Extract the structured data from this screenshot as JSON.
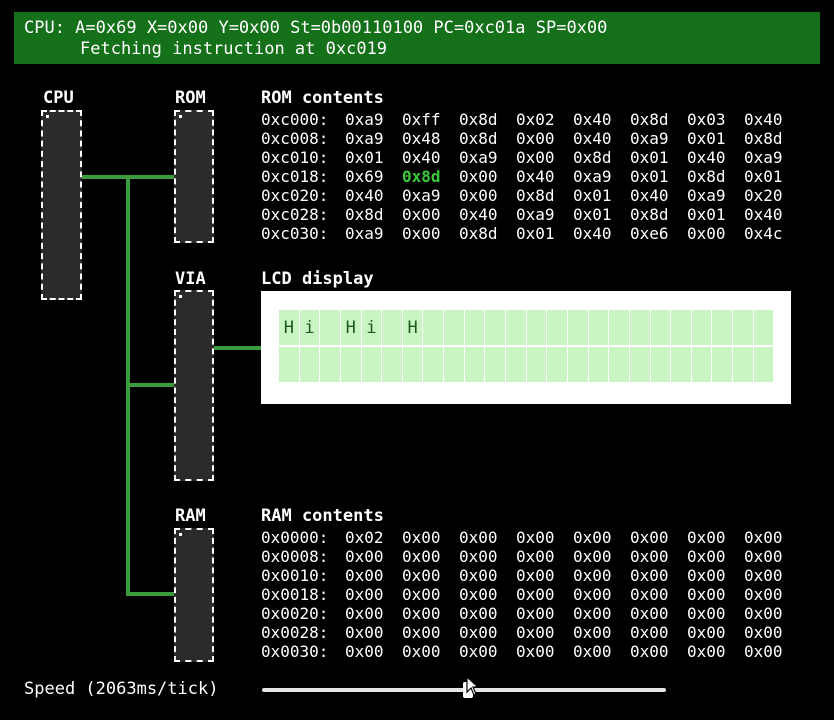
{
  "status": {
    "line1": "CPU: A=0x69  X=0x00  Y=0x00  St=0b00110100  PC=0xc01a  SP=0x00",
    "line2": "Fetching instruction at 0xc019"
  },
  "chips": {
    "cpu": "CPU",
    "rom": "ROM",
    "via": "VIA",
    "ram": "RAM"
  },
  "rom": {
    "title": "ROM contents",
    "highlight": {
      "row": 3,
      "col": 1
    },
    "rows": [
      {
        "addr": "0xc000:",
        "bytes": [
          "0xa9",
          "0xff",
          "0x8d",
          "0x02",
          "0x40",
          "0x8d",
          "0x03",
          "0x40"
        ]
      },
      {
        "addr": "0xc008:",
        "bytes": [
          "0xa9",
          "0x48",
          "0x8d",
          "0x00",
          "0x40",
          "0xa9",
          "0x01",
          "0x8d"
        ]
      },
      {
        "addr": "0xc010:",
        "bytes": [
          "0x01",
          "0x40",
          "0xa9",
          "0x00",
          "0x8d",
          "0x01",
          "0x40",
          "0xa9"
        ]
      },
      {
        "addr": "0xc018:",
        "bytes": [
          "0x69",
          "0x8d",
          "0x00",
          "0x40",
          "0xa9",
          "0x01",
          "0x8d",
          "0x01"
        ]
      },
      {
        "addr": "0xc020:",
        "bytes": [
          "0x40",
          "0xa9",
          "0x00",
          "0x8d",
          "0x01",
          "0x40",
          "0xa9",
          "0x20"
        ]
      },
      {
        "addr": "0xc028:",
        "bytes": [
          "0x8d",
          "0x00",
          "0x40",
          "0xa9",
          "0x01",
          "0x8d",
          "0x01",
          "0x40"
        ]
      },
      {
        "addr": "0xc030:",
        "bytes": [
          "0xa9",
          "0x00",
          "0x8d",
          "0x01",
          "0x40",
          "0xe6",
          "0x00",
          "0x4c"
        ]
      }
    ]
  },
  "lcd": {
    "title": "LCD display",
    "columns": 24,
    "rows": [
      [
        "H",
        "i",
        "",
        "H",
        "i",
        "",
        "H",
        "",
        "",
        "",
        "",
        "",
        "",
        "",
        "",
        "",
        "",
        "",
        "",
        "",
        "",
        "",
        "",
        ""
      ],
      [
        "",
        "",
        "",
        "",
        "",
        "",
        "",
        "",
        "",
        "",
        "",
        "",
        "",
        "",
        "",
        "",
        "",
        "",
        "",
        "",
        "",
        "",
        "",
        ""
      ]
    ]
  },
  "ram": {
    "title": "RAM contents",
    "rows": [
      {
        "addr": "0x0000:",
        "bytes": [
          "0x02",
          "0x00",
          "0x00",
          "0x00",
          "0x00",
          "0x00",
          "0x00",
          "0x00"
        ]
      },
      {
        "addr": "0x0008:",
        "bytes": [
          "0x00",
          "0x00",
          "0x00",
          "0x00",
          "0x00",
          "0x00",
          "0x00",
          "0x00"
        ]
      },
      {
        "addr": "0x0010:",
        "bytes": [
          "0x00",
          "0x00",
          "0x00",
          "0x00",
          "0x00",
          "0x00",
          "0x00",
          "0x00"
        ]
      },
      {
        "addr": "0x0018:",
        "bytes": [
          "0x00",
          "0x00",
          "0x00",
          "0x00",
          "0x00",
          "0x00",
          "0x00",
          "0x00"
        ]
      },
      {
        "addr": "0x0020:",
        "bytes": [
          "0x00",
          "0x00",
          "0x00",
          "0x00",
          "0x00",
          "0x00",
          "0x00",
          "0x00"
        ]
      },
      {
        "addr": "0x0028:",
        "bytes": [
          "0x00",
          "0x00",
          "0x00",
          "0x00",
          "0x00",
          "0x00",
          "0x00",
          "0x00"
        ]
      },
      {
        "addr": "0x0030:",
        "bytes": [
          "0x00",
          "0x00",
          "0x00",
          "0x00",
          "0x00",
          "0x00",
          "0x00",
          "0x00"
        ]
      }
    ]
  },
  "speed": {
    "label": "Speed (2063ms/tick)",
    "slider_fraction": 0.51
  },
  "colors": {
    "status_bg": "#15701a",
    "bus": "#3a9a3e",
    "highlight": "#3ac83a",
    "lcd_cell": "#c9f5c2"
  },
  "icons": {
    "cursor": "mouse-pointer-icon"
  }
}
